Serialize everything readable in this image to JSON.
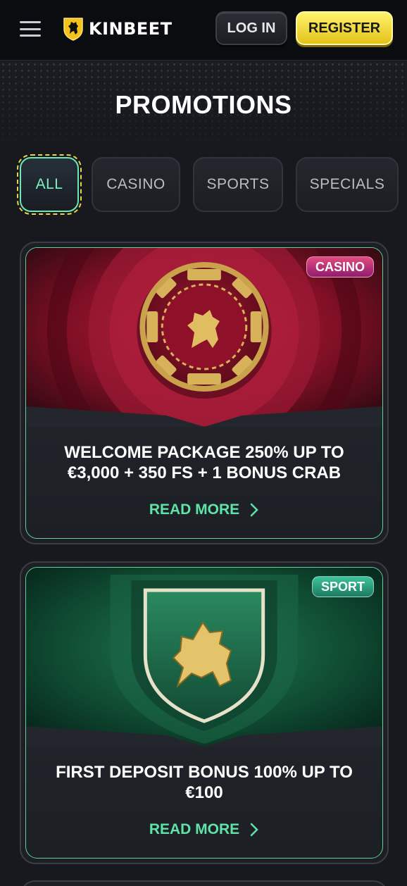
{
  "header": {
    "brand": "KINBEET",
    "login_label": "LOG IN",
    "register_label": "REGISTER"
  },
  "page": {
    "title": "PROMOTIONS"
  },
  "tabs": [
    {
      "label": "ALL",
      "active": true
    },
    {
      "label": "CASINO",
      "active": false
    },
    {
      "label": "SPORTS",
      "active": false
    },
    {
      "label": "SPECIALS",
      "active": false
    }
  ],
  "promotions": [
    {
      "badge": "CASINO",
      "title": "WELCOME PACKAGE 250% UP TO €3,000 + 350 FS + 1 BONUS CRAB",
      "cta": "READ MORE",
      "image": "casino-chip-lion"
    },
    {
      "badge": "SPORT",
      "title": "FIRST DEPOSIT BONUS 100% UP TO €100",
      "cta": "READ MORE",
      "image": "green-shield-lion"
    }
  ],
  "colors": {
    "accent_green": "#5fe3a7",
    "register_yellow": "#f2d93a",
    "casino_badge": "#c43578",
    "sport_badge": "#2fa582",
    "background": "#17191e"
  },
  "icons": [
    "hamburger-icon",
    "lion-shield-logo",
    "chevron-right-icon"
  ]
}
